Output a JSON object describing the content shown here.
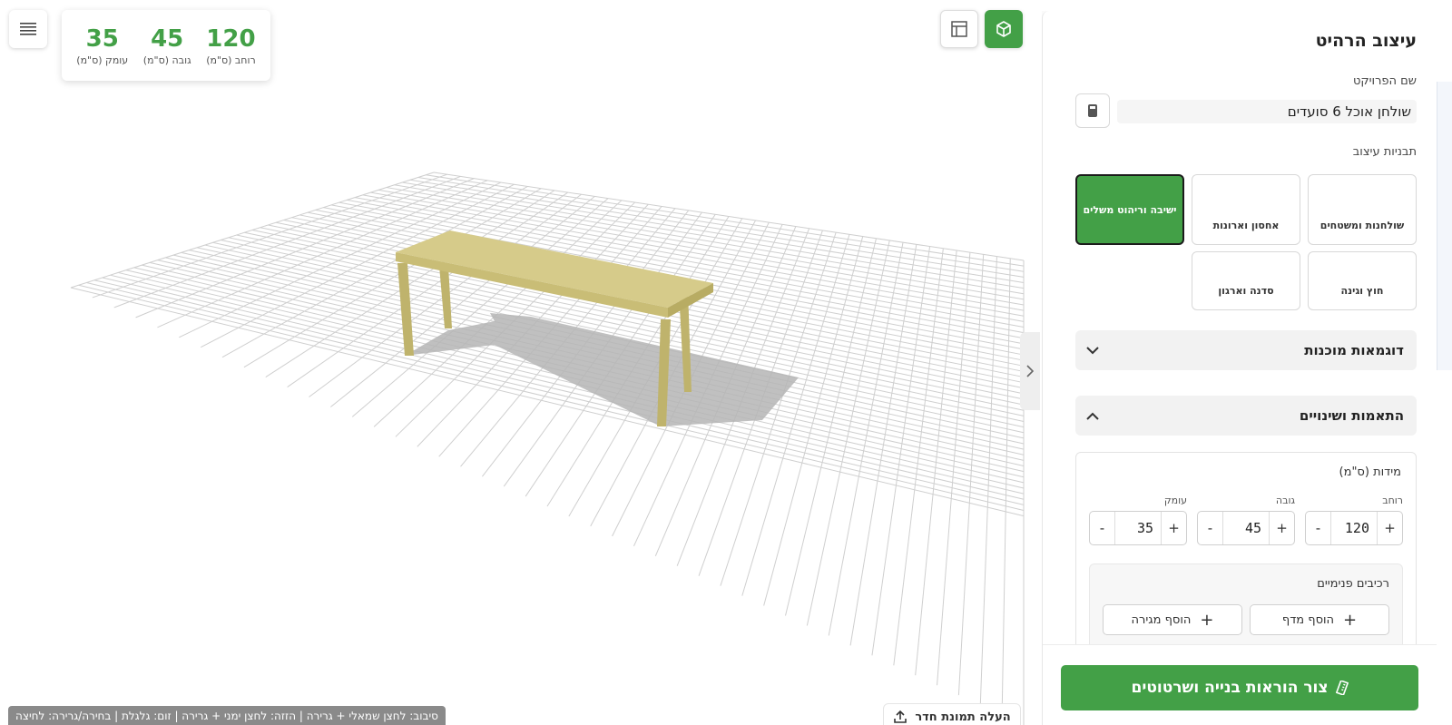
{
  "viewport": {
    "dimensions": [
      {
        "value": "35",
        "label": "עומק (ס\"מ)"
      },
      {
        "value": "45",
        "label": "גובה (ס\"מ)"
      },
      {
        "value": "120",
        "label": "רוחב (ס\"מ)"
      }
    ],
    "status_text": "סיבוב: לחצן שמאלי + גרירה | הזזה: לחצן ימני + גרירה | זום: גלגלת | בחירה/גרירה: לחיצה",
    "upload_label": "העלה תמונת חדר",
    "active_view": "3d",
    "colors": {
      "accent": "#43a047",
      "table_top": "#d6cb8a",
      "table_leg": "#bfb36c",
      "shadow": "#b5b5b5"
    }
  },
  "panel": {
    "title": "עיצוב הרהיט",
    "project_name_label": "שם הפרויקט",
    "project_name_value": "שולחן אוכל 6 סועדים",
    "templates_label": "תבניות עיצוב",
    "templates": [
      {
        "label": "שולחנות ומשטחים",
        "active": false
      },
      {
        "label": "אחסון וארונות",
        "active": false
      },
      {
        "label": "ישיבה וריהוט משלים",
        "active": true
      },
      {
        "label": "חוץ וגינה",
        "active": false
      },
      {
        "label": "סדנה וארגון",
        "active": false
      }
    ],
    "ready_examples_label": "דוגמאות מוכנות",
    "adjustments_label": "התאמות ושינויים",
    "dimensions": {
      "title": "מידות (ס\"מ)",
      "width_label": "רוחב",
      "width_value": "120",
      "height_label": "גובה",
      "height_value": "45",
      "depth_label": "עומק",
      "depth_value": "35"
    },
    "inner_components": {
      "title": "רכיבים פנימיים",
      "add_shelf": "הוסף מדף",
      "add_drawer": "הוסף מגירה"
    },
    "generate_button": "צור הוראות בנייה ושרטוטים"
  }
}
